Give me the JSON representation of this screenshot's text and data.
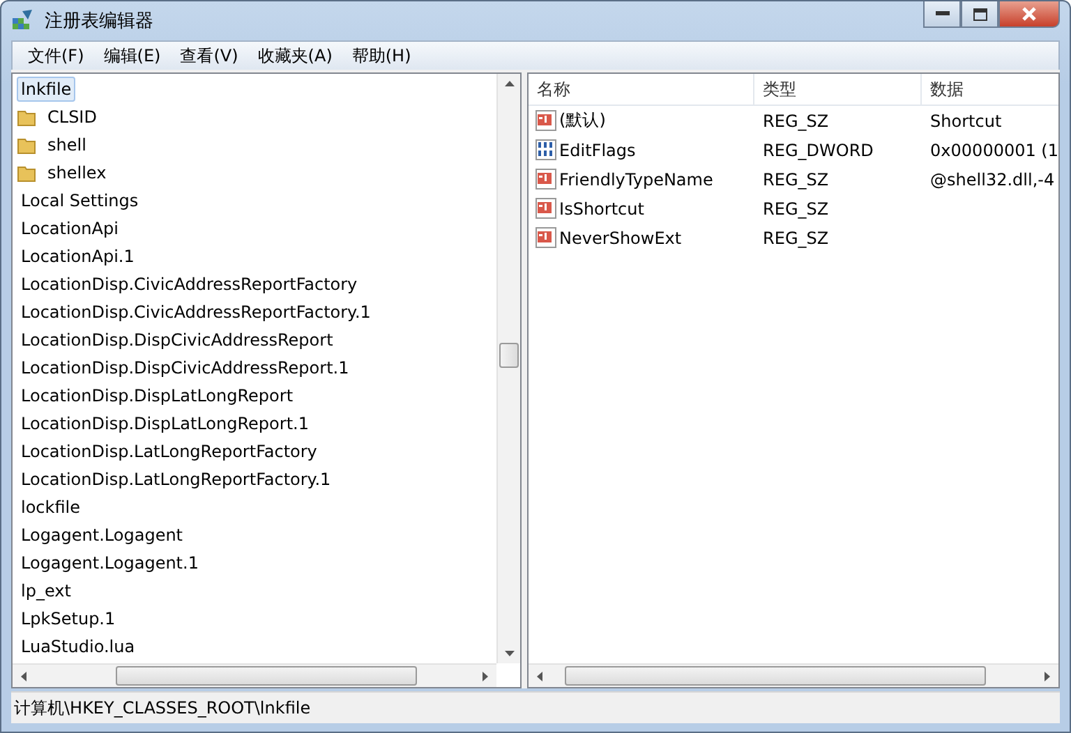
{
  "window": {
    "title": "注册表编辑器"
  },
  "menu": [
    "文件(F)",
    "编辑(E)",
    "查看(V)",
    "收藏夹(A)",
    "帮助(H)"
  ],
  "tree": [
    {
      "label": "lnkfile",
      "selected": true,
      "children": [
        {
          "label": "CLSID",
          "selected": false
        },
        {
          "label": "shell",
          "selected": false
        },
        {
          "label": "shellex",
          "selected": false
        }
      ]
    },
    {
      "label": "Local Settings",
      "selected": false
    },
    {
      "label": "LocationApi",
      "selected": false
    },
    {
      "label": "LocationApi.1",
      "selected": false
    },
    {
      "label": "LocationDisp.CivicAddressReportFactory",
      "selected": false
    },
    {
      "label": "LocationDisp.CivicAddressReportFactory.1",
      "selected": false
    },
    {
      "label": "LocationDisp.DispCivicAddressReport",
      "selected": false
    },
    {
      "label": "LocationDisp.DispCivicAddressReport.1",
      "selected": false
    },
    {
      "label": "LocationDisp.DispLatLongReport",
      "selected": false
    },
    {
      "label": "LocationDisp.DispLatLongReport.1",
      "selected": false
    },
    {
      "label": "LocationDisp.LatLongReportFactory",
      "selected": false
    },
    {
      "label": "LocationDisp.LatLongReportFactory.1",
      "selected": false
    },
    {
      "label": "lockfile",
      "selected": false
    },
    {
      "label": "Logagent.Logagent",
      "selected": false
    },
    {
      "label": "Logagent.Logagent.1",
      "selected": false
    },
    {
      "label": "lp_ext",
      "selected": false
    },
    {
      "label": "LpkSetup.1",
      "selected": false
    },
    {
      "label": "LuaStudio.lua",
      "selected": false
    }
  ],
  "table": {
    "columns": [
      "名称",
      "类型",
      "数据"
    ],
    "rows": [
      {
        "kind": "string",
        "name": "(默认)",
        "type": "REG_SZ",
        "data": "Shortcut"
      },
      {
        "kind": "binary",
        "name": "EditFlags",
        "type": "REG_DWORD",
        "data": "0x00000001 (1"
      },
      {
        "kind": "string",
        "name": "FriendlyTypeName",
        "type": "REG_SZ",
        "data": "@shell32.dll,-4"
      },
      {
        "kind": "string",
        "name": "IsShortcut",
        "type": "REG_SZ"
      },
      {
        "kind": "string",
        "name": "NeverShowExt",
        "type": "REG_SZ"
      }
    ]
  },
  "status_bar": "计算机\\HKEY_CLASSES_ROOT\\lnkfile"
}
